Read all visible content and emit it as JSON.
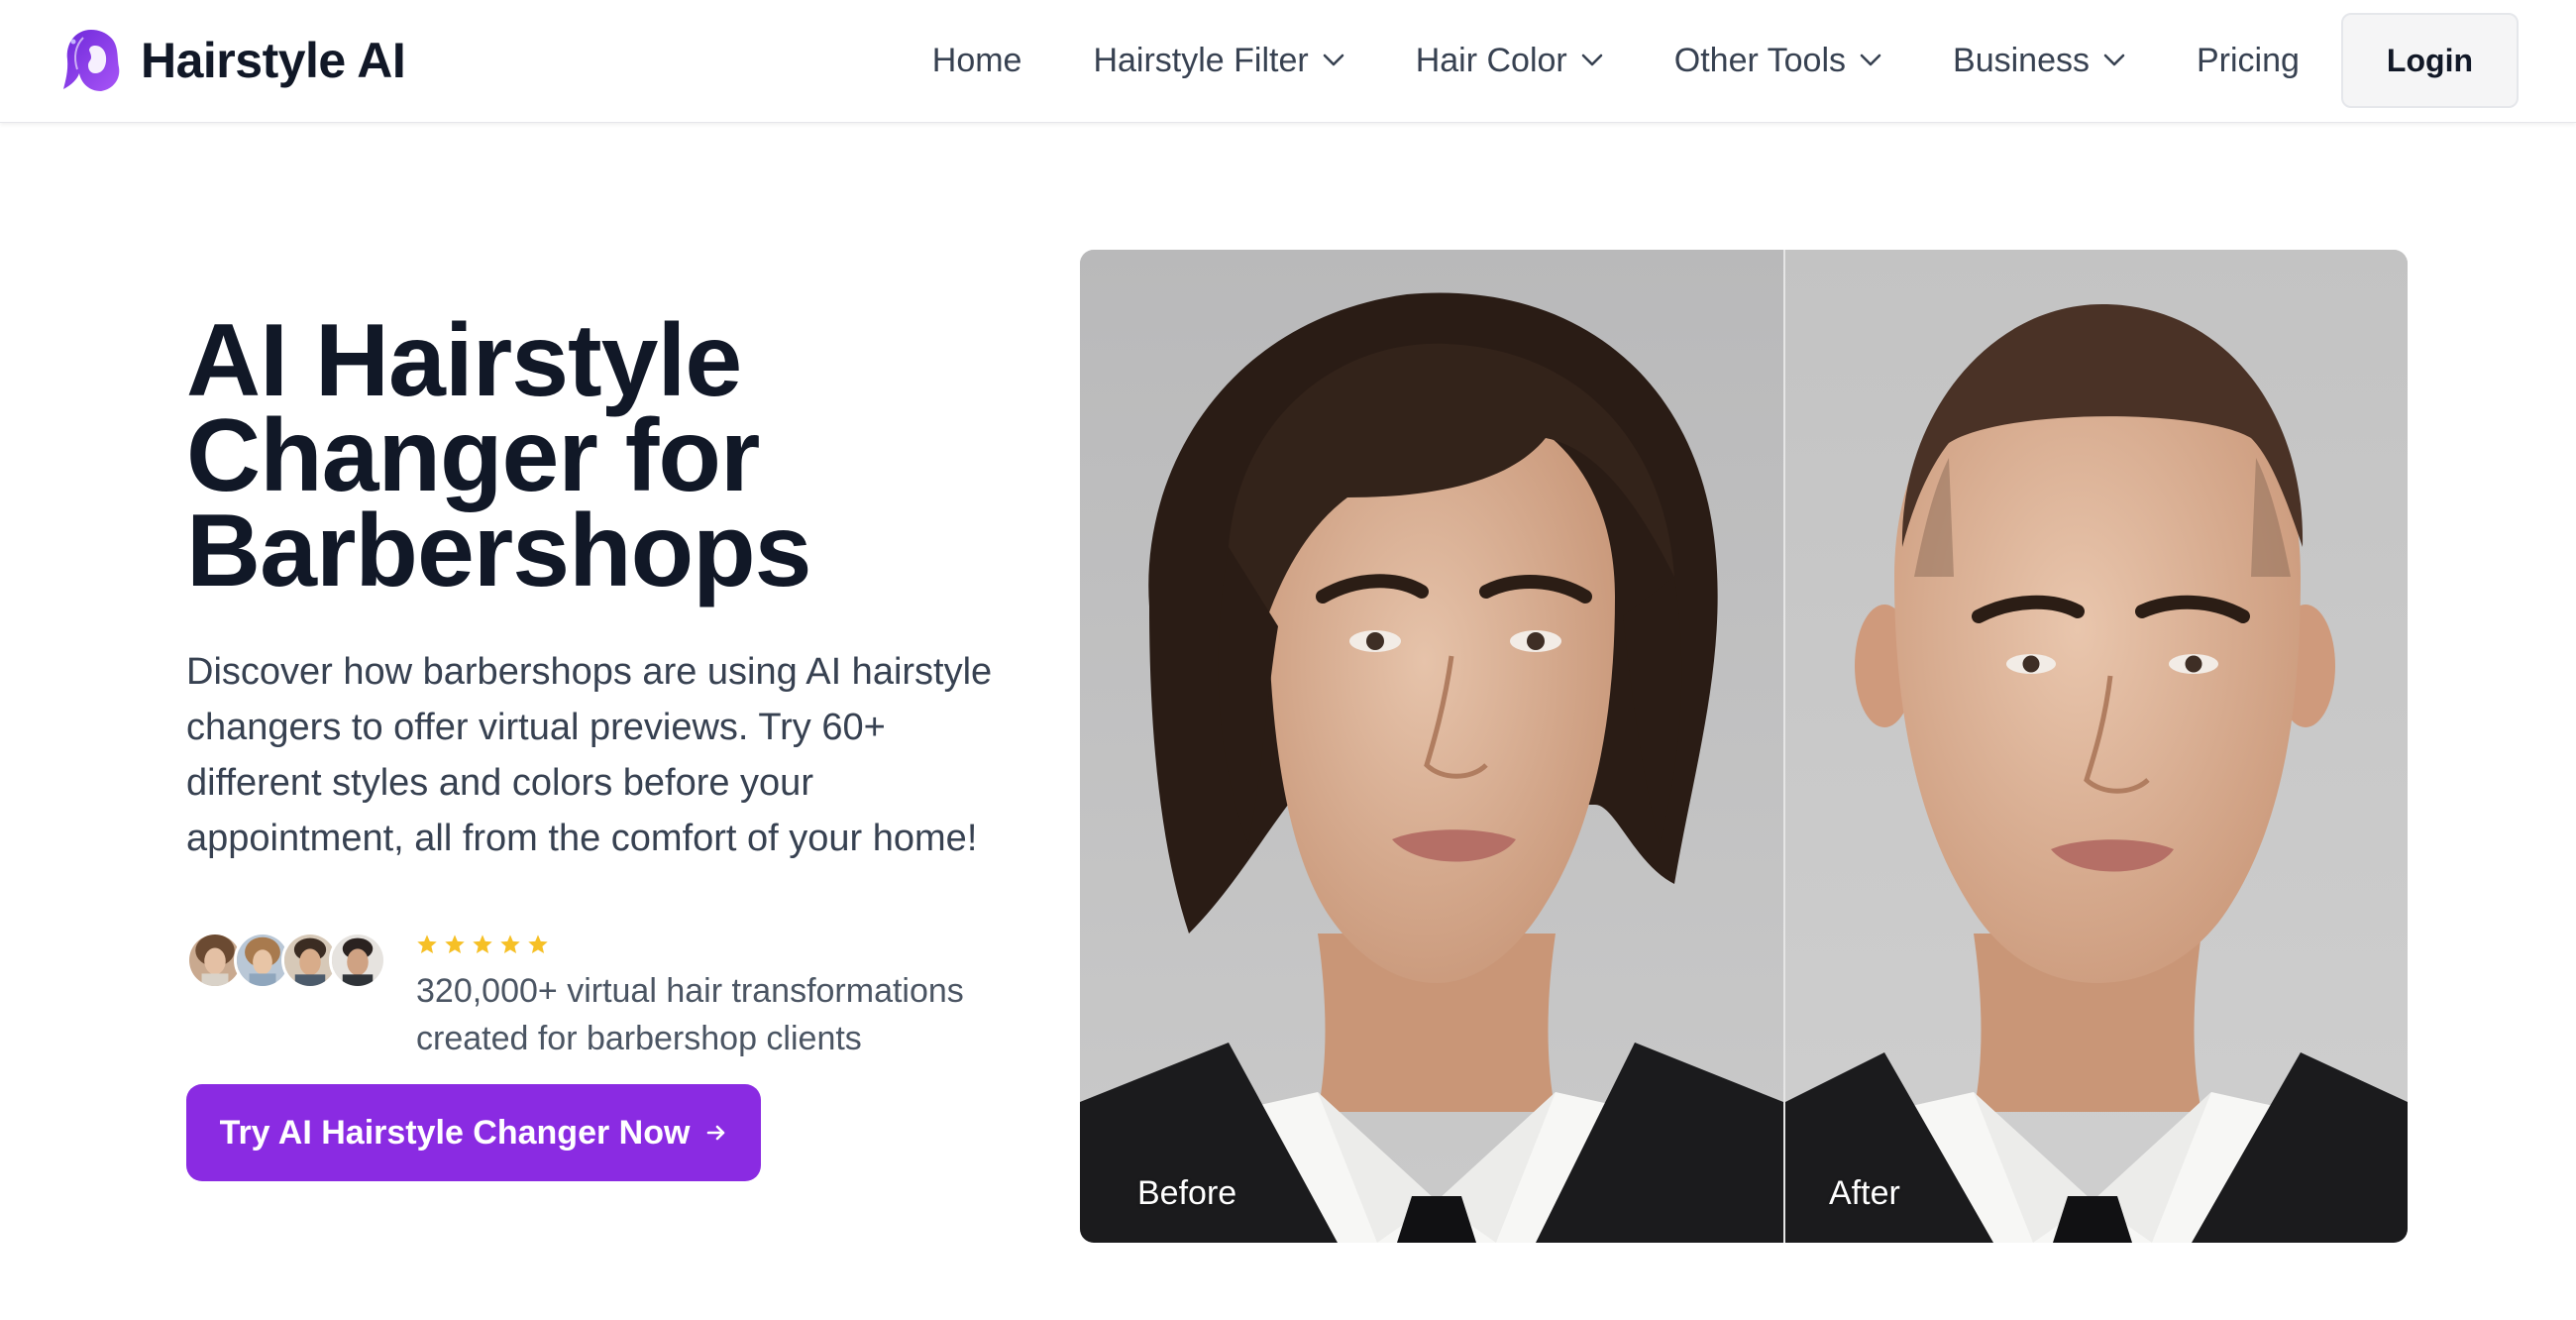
{
  "brand": {
    "name": "Hairstyle AI",
    "logo_icon": "woman-silhouette-logo-icon",
    "accent_color": "#8a2be2"
  },
  "nav": {
    "items": [
      {
        "label": "Home",
        "has_dropdown": false
      },
      {
        "label": "Hairstyle Filter",
        "has_dropdown": true
      },
      {
        "label": "Hair Color",
        "has_dropdown": true
      },
      {
        "label": "Other Tools",
        "has_dropdown": true
      },
      {
        "label": "Business",
        "has_dropdown": true
      },
      {
        "label": "Pricing",
        "has_dropdown": false
      }
    ],
    "login_label": "Login"
  },
  "hero": {
    "title_lines": [
      "AI Hairstyle",
      "Changer for",
      "Barbershops"
    ],
    "description": "Discover how barbershops are using AI hairstyle changers to offer virtual previews. Try 60+ different styles and colors before your appointment, all from the comfort of your home!",
    "rating_stars": 5,
    "star_color": "#f6c026",
    "proof_text": "320,000+ virtual hair transformations created for barbershop clients",
    "cta_label": "Try AI Hairstyle Changer Now",
    "cta_icon": "arrow-right-icon"
  },
  "comparison": {
    "before_label": "Before",
    "after_label": "After"
  }
}
